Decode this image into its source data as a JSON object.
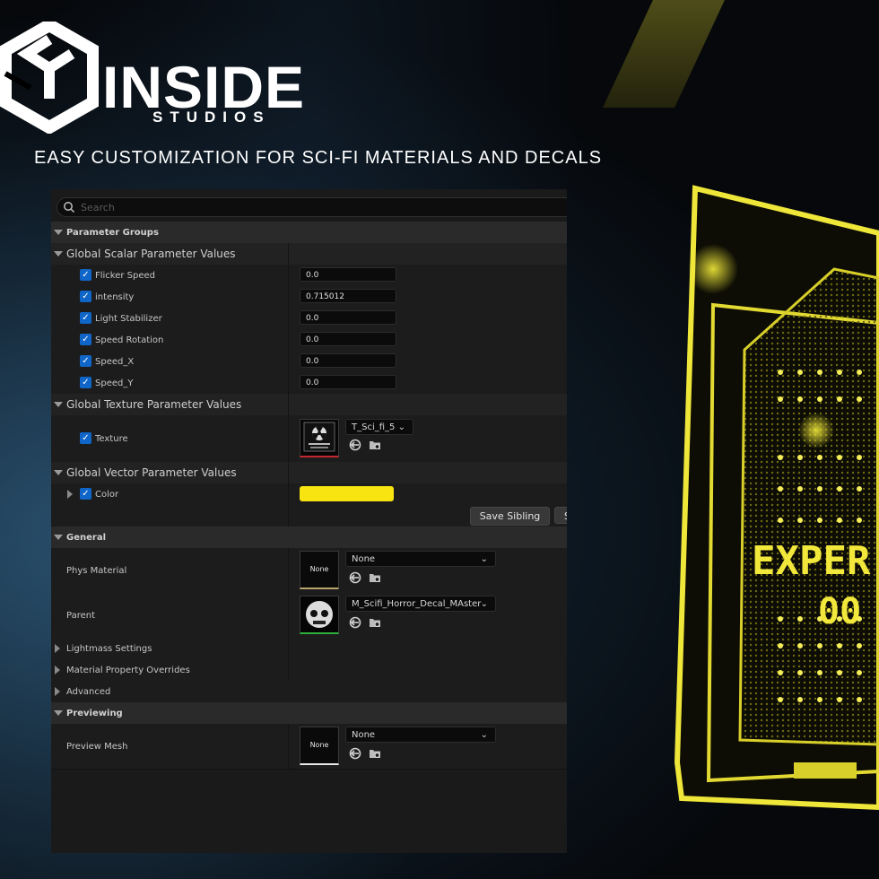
{
  "brand": {
    "name": "INSIDE",
    "sub": "STUDIOS"
  },
  "headline": "EASY CUSTOMIZATION FOR SCI-FI MATERIALS AND DECALS",
  "neon_text": {
    "line1": "EXPER",
    "line2": "00"
  },
  "search": {
    "placeholder": "Search"
  },
  "sections": {
    "parameter_groups": "Parameter Groups",
    "global_scalar": "Global Scalar Parameter Values",
    "global_texture": "Global Texture Parameter Values",
    "global_vector": "Global Vector Parameter Values",
    "general": "General",
    "lightmass": "Lightmass Settings",
    "overrides": "Material Property Overrides",
    "advanced": "Advanced",
    "previewing": "Previewing"
  },
  "scalars": [
    {
      "label": "Flicker Speed",
      "value": "0.0",
      "checked": true
    },
    {
      "label": "intensity",
      "value": "0.715012",
      "checked": true
    },
    {
      "label": "Light Stabilizer",
      "value": "0.0",
      "checked": true
    },
    {
      "label": "Speed Rotation",
      "value": "0.0",
      "checked": true
    },
    {
      "label": "Speed_X",
      "value": "0.0",
      "checked": true
    },
    {
      "label": "Speed_Y",
      "value": "0.0",
      "checked": true
    }
  ],
  "texture": {
    "label": "Texture",
    "value": "T_Sci_fi_5"
  },
  "vector": {
    "label": "Color",
    "color": "#f7e411"
  },
  "buttons": {
    "save_sibling": "Save Sibling",
    "save_child": "S"
  },
  "general": {
    "phys_material": {
      "label": "Phys Material",
      "thumb": "None",
      "value": "None"
    },
    "parent": {
      "label": "Parent",
      "value": "M_Scifi_Horror_Decal_MAster"
    }
  },
  "preview": {
    "label": "Preview Mesh",
    "thumb": "None",
    "value": "None"
  },
  "colors": {
    "accent": "#1066c8",
    "neon": "#f2e41a",
    "panel": "#1a1a1a"
  }
}
